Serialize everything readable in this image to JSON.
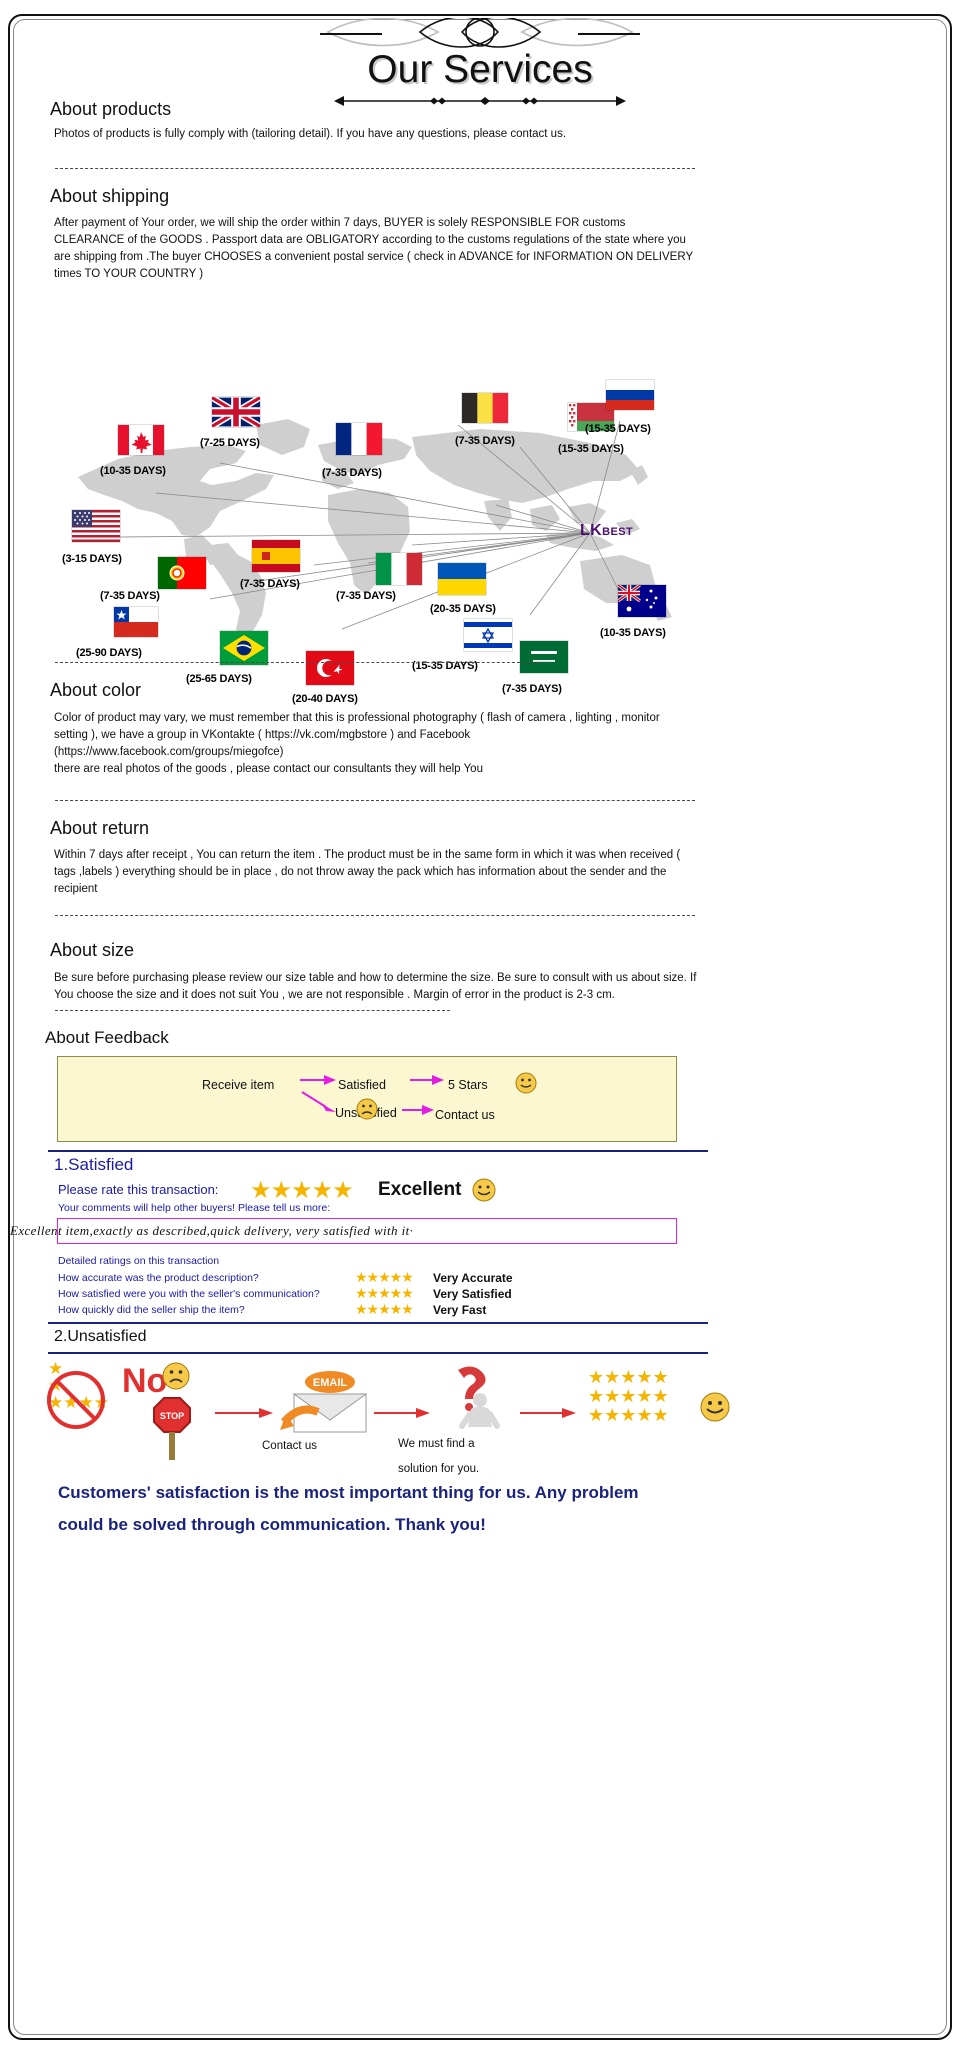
{
  "header": {
    "title": "Our Services"
  },
  "sections": [
    {
      "heading": "About products",
      "body": "Photos of products is fully comply with (tailoring detail). If you have any questions, please contact us."
    },
    {
      "heading": "About shipping",
      "body": "After payment of Your order, we will ship the order within 7 days, BUYER is solely RESPONSIBLE FOR customs CLEARANCE of the GOODS . Passport data are OBLIGATORY according to the customs regulations of the state where you are shipping from .The buyer CHOOSES a convenient postal service ( check in ADVANCE for INFORMATION ON DELIVERY times TO YOUR COUNTRY )"
    },
    {
      "heading": "About color",
      "body": "Color of product may vary, we must remember that this is professional photography ( flash of camera , lighting , monitor setting ), we have a group in VKontakte ( https://vk.com/mgbstore ) and Facebook (https://www.facebook.com/groups/miegofce)\n there are real photos of the goods , please contact our consultants they will help You"
    },
    {
      "heading": "About return",
      "body": "Within 7 days after receipt , You can return the item . The product must be in the same form in which it was when received ( tags ,labels ) everything should be in place , do not throw away the pack which has information about the sender and the recipient"
    },
    {
      "heading": "About size",
      "body": "Be sure before purchasing  please review our size table and how to determine the size. Be sure to consult with us about size. If You choose the size and it does not suit You , we are not responsible . Margin of error in the product is 2-3 cm."
    }
  ],
  "map": {
    "hub_label_bold": "LK",
    "hub_label_small": "BEST",
    "destinations": [
      {
        "country": "canada",
        "days": "(10-35 DAYS)"
      },
      {
        "country": "united-kingdom",
        "days": "(7-25 DAYS)"
      },
      {
        "country": "france",
        "days": "(7-35 DAYS)"
      },
      {
        "country": "belgium",
        "days": "(7-35 DAYS)"
      },
      {
        "country": "belarus",
        "days": "(15-35 DAYS)"
      },
      {
        "country": "russia",
        "days": "(15-35 DAYS)"
      },
      {
        "country": "united-states",
        "days": "(3-15 DAYS)"
      },
      {
        "country": "portugal",
        "days": "(7-35 DAYS)"
      },
      {
        "country": "spain",
        "days": "(7-35 DAYS)"
      },
      {
        "country": "italy",
        "days": "(7-35 DAYS)"
      },
      {
        "country": "ukraine",
        "days": "(20-35 DAYS)"
      },
      {
        "country": "chile",
        "days": "(25-90 DAYS)"
      },
      {
        "country": "brazil",
        "days": "(25-65 DAYS)"
      },
      {
        "country": "turkey",
        "days": "(20-40 DAYS)"
      },
      {
        "country": "israel",
        "days": "(15-35 DAYS)"
      },
      {
        "country": "saudi-arabia",
        "days": "(7-35 DAYS)"
      },
      {
        "country": "australia",
        "days": "(10-35 DAYS)"
      }
    ]
  },
  "feedback": {
    "title": "About Feedback",
    "flow": {
      "receive": "Receive item",
      "satisfied": "Satisfied",
      "five_stars": "5 Stars",
      "unsatisfied": "Unsatisfied",
      "contact": "Contact us"
    },
    "satisfied": {
      "heading": "1.Satisfied",
      "rate_prompt": "Please rate this transaction:",
      "stars": "★★★★★",
      "excellent": "Excellent",
      "comment_prompt": "Your comments will help other buyers! Please tell us more:",
      "review_text": "Excellent item,exactly as described,quick delivery, very satisfied with it·",
      "detailed_label": "Detailed ratings on this transaction",
      "rows": [
        {
          "label": "How accurate was the product description?",
          "stars": "★★★★★",
          "value": "Very Accurate"
        },
        {
          "label": "How satisfied were you with the seller's communication?",
          "stars": "★★★★★",
          "value": "Very Satisfied"
        },
        {
          "label": "How quickly did the seller ship the item?",
          "stars": "★★★★★",
          "value": "Very Fast"
        }
      ]
    },
    "unsatisfied": {
      "heading": "2.Unsatisfied",
      "no_label": "No",
      "stop_label": "STOP",
      "email_label": "EMAIL",
      "contact_caption": "Contact us",
      "solution_caption_line1": "We must find a",
      "solution_caption_line2": "solution for you.",
      "stars_block": "★★★★★"
    },
    "closing_line1": "Customers' satisfaction is the most important thing for us. Any problem",
    "closing_line2": "could be solved through communication. Thank you!"
  },
  "colors": {
    "accent_yellow": "#fbf7d0",
    "star_gold": "#f5b400",
    "navy": "#1a237e",
    "pink": "#e11ee1",
    "red_arrow": "#e03030",
    "hub_purple": "#4b1070",
    "map_gray": "#cfcfcf"
  }
}
